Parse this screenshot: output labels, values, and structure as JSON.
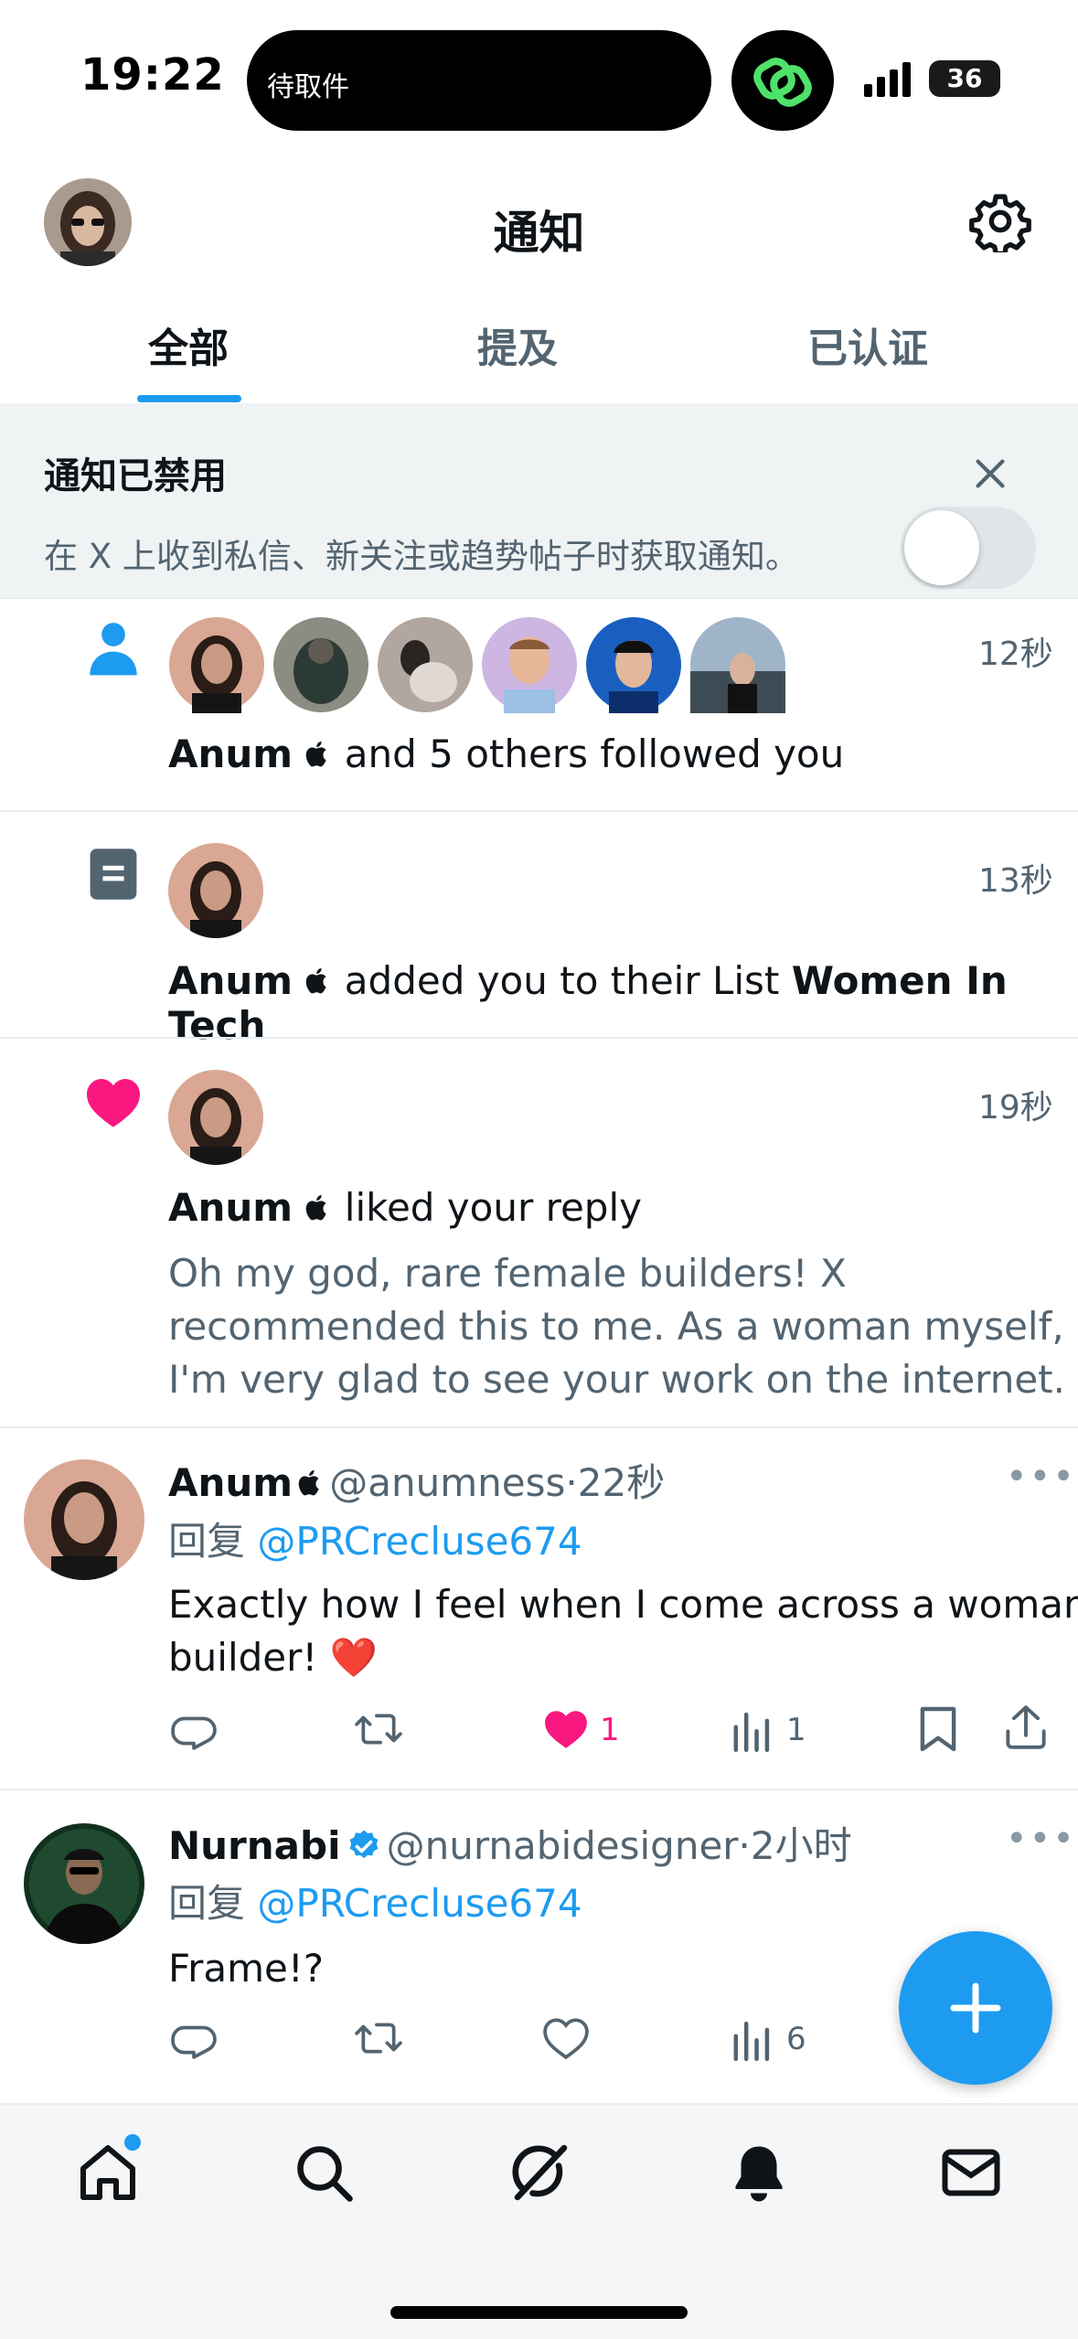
{
  "status_bar": {
    "time": "19:22",
    "island_text": "待取件",
    "battery": "36"
  },
  "header": {
    "title": "通知"
  },
  "tabs": [
    {
      "label": "全部",
      "active": true
    },
    {
      "label": "提及",
      "active": false
    },
    {
      "label": "已认证",
      "active": false
    }
  ],
  "banner": {
    "title": "通知已禁用",
    "text": "在 X 上收到私信、新关注或趋势帖子时获取通知。",
    "toggle_on": false
  },
  "notifications": [
    {
      "type": "follow",
      "time": "12秒",
      "name": "Anum",
      "text": "and 5 others followed you"
    },
    {
      "type": "list",
      "time": "13秒",
      "name": "Anum",
      "text": "added you to their List",
      "list_name": "Women In Tech"
    },
    {
      "type": "like",
      "time": "19秒",
      "name": "Anum",
      "text": "liked your reply",
      "quote": "Oh my god, rare female builders! X recommended this to me. As a woman myself, I'm very glad to see your work on the internet."
    }
  ],
  "tweets": [
    {
      "name": "Anum",
      "handle": "@anumness",
      "time": "22秒",
      "reply_prefix": "回复",
      "reply_handle": "@PRCrecluse674",
      "body": "Exactly how I feel when I come across a woman builder! ❤️",
      "likes": "1",
      "views": "1",
      "liked": true
    },
    {
      "name": "Nurnabi",
      "handle": "@nurnabidesigner",
      "time": "2小时",
      "reply_prefix": "回复",
      "reply_handle": "@PRCrecluse674",
      "body": "Frame!?",
      "likes": "",
      "views": "6",
      "liked": false
    }
  ],
  "colors": {
    "accent": "#1d9bf0",
    "like": "#f91880",
    "text": "#0f1419",
    "muted": "#536471"
  },
  "icons": [
    "settings-gear-icon",
    "close-icon",
    "person-icon",
    "list-icon",
    "heart-icon",
    "reply-icon",
    "retweet-icon",
    "views-icon",
    "bookmark-icon",
    "share-icon",
    "plus-icon",
    "home-icon",
    "search-icon",
    "grok-icon",
    "bell-icon",
    "mail-icon"
  ]
}
